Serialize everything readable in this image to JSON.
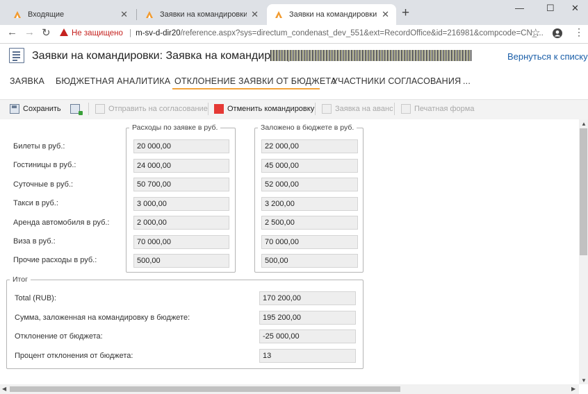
{
  "browser": {
    "tabs": [
      {
        "title": "Входящие"
      },
      {
        "title": "Заявки на командировки"
      },
      {
        "title": "Заявки на командировки: Заявк"
      }
    ],
    "new_tab": "+",
    "window_controls": {
      "minimize": "—",
      "maximize": "☐",
      "close": "✕"
    },
    "security_label": "Не защищено",
    "url_host": "m-sv-d-dir20",
    "url_path": "/reference.aspx?sys=directum_condenast_dev_551&ext=RecordOffice&id=216981&compcode=CN_..."
  },
  "app": {
    "title": "Заявки на командировки: Заявка на командировку",
    "back_link": "Вернуться к списку",
    "tabs": [
      {
        "label": "ЗАЯВКА"
      },
      {
        "label": "БЮДЖЕТНАЯ АНАЛИТИКА"
      },
      {
        "label": "ОТКЛОНЕНИЕ ЗАЯВКИ ОТ БЮДЖЕТА"
      },
      {
        "label": "УЧАСТНИКИ СОГЛАСОВАНИЯ"
      },
      {
        "label": "..."
      }
    ],
    "active_tab": "ОТКЛОНЕНИЕ ЗАЯВКИ ОТ БЮДЖЕТА",
    "toolbar": {
      "save": "Сохранить",
      "send": "Отправить на согласование",
      "cancel": "Отменить командировку",
      "advance": "Заявка на аванс",
      "print": "Печатная форма"
    }
  },
  "expenses": {
    "request_legend": "Расходы по заявке в руб.",
    "budget_legend": "Заложено в бюджете в руб.",
    "rows": [
      {
        "label": "Билеты в руб.:",
        "request": "20 000,00",
        "budget": "22 000,00"
      },
      {
        "label": "Гостиницы в руб.:",
        "request": "24 000,00",
        "budget": "45 000,00"
      },
      {
        "label": "Суточные в руб.:",
        "request": "50 700,00",
        "budget": "52 000,00"
      },
      {
        "label": "Такси в руб.:",
        "request": "3 000,00",
        "budget": "3 200,00"
      },
      {
        "label": "Аренда автомобиля в руб.:",
        "request": "2 000,00",
        "budget": "2 500,00"
      },
      {
        "label": "Виза в руб.:",
        "request": "70 000,00",
        "budget": "70 000,00"
      },
      {
        "label": "Прочие расходы в руб.:",
        "request": "500,00",
        "budget": "500,00"
      }
    ]
  },
  "totals": {
    "legend": "Итог",
    "rows": [
      {
        "label": "Total (RUB):",
        "value": "170 200,00"
      },
      {
        "label": "Сумма, заложенная на командировку в бюджете:",
        "value": "195 200,00"
      },
      {
        "label": "Отклонение от бюджета:",
        "value": "-25 000,00"
      },
      {
        "label": "Процент отклонения от бюджета:",
        "value": "13"
      }
    ]
  },
  "colors": {
    "accent": "#f2a33a",
    "link": "#1a5ea8",
    "warning": "#c5221f",
    "cancel_icon": "#e53935"
  }
}
